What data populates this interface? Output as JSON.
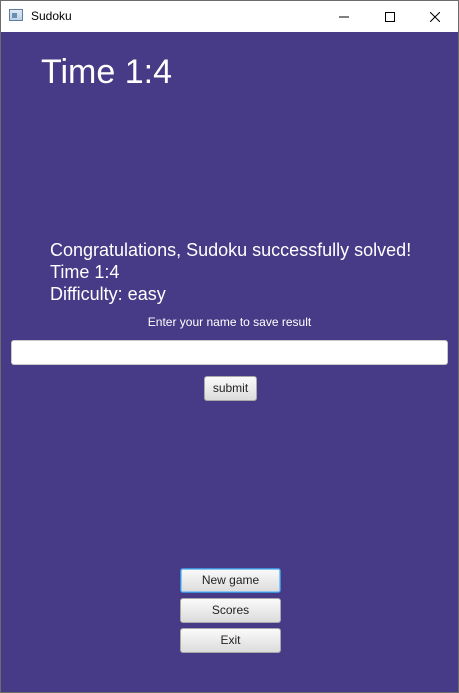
{
  "window": {
    "title": "Sudoku",
    "controls": {
      "minimize": "minimize-icon",
      "maximize": "maximize-icon",
      "close": "close-icon"
    }
  },
  "timer": {
    "text": "Time 1:4"
  },
  "result": {
    "message": "Congratulations, Sudoku successfully solved!",
    "time": "Time 1:4",
    "difficulty": "Difficulty: easy"
  },
  "save": {
    "prompt": "Enter your name to save result",
    "name_value": "",
    "submit_label": "submit"
  },
  "menu": {
    "new_game_label": "New game",
    "scores_label": "Scores",
    "exit_label": "Exit"
  },
  "colors": {
    "background": "#473a86",
    "text": "#ffffff",
    "focus": "#3c8ed6"
  }
}
